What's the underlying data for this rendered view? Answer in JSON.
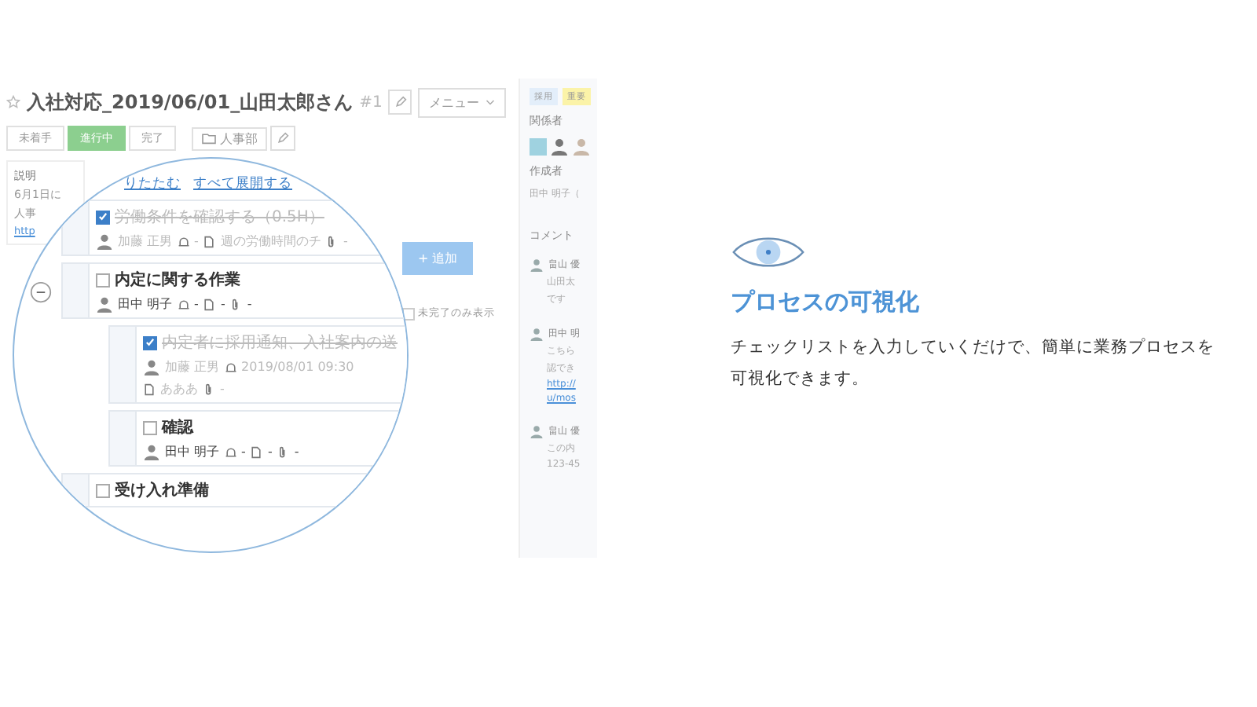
{
  "app": {
    "title": "入社対応_2019/06/01_山田太郎さん",
    "number": "#1",
    "menu": "メニュー",
    "status_tabs": [
      {
        "label": "未着手",
        "selected": false
      },
      {
        "label": "進行中",
        "selected": true
      },
      {
        "label": "完了",
        "selected": false
      }
    ],
    "folder": "人事部",
    "description": {
      "label": "説明",
      "lines": [
        "6月1日に",
        "人事"
      ],
      "link": "http"
    },
    "add_button": "+ 追加",
    "filter": {
      "label": "未完了のみ表示",
      "checked": false
    },
    "sidebar": {
      "tags": [
        {
          "label": "採用",
          "color": "#e3eefa"
        },
        {
          "label": "重要",
          "color": "#fbf3a8"
        }
      ],
      "members_label": "関係者",
      "author_label": "作成者",
      "author": "田中 明子（",
      "comments_label": "コメント",
      "comments": [
        {
          "author": "畠山 優",
          "lines": [
            "山田太",
            "です"
          ]
        },
        {
          "author": "田中 明",
          "lines": [
            "こちら",
            "認でき"
          ],
          "links": [
            "http://",
            "u/mos"
          ]
        },
        {
          "author": "畠山 優",
          "lines": [
            "この内",
            "123-45"
          ]
        }
      ]
    }
  },
  "magnifier": {
    "toolbar": [
      "りたたむ",
      "すべて展開する"
    ],
    "items": [
      {
        "title": "労働条件を確認する（0.5H）",
        "checked": true,
        "assignee": "加藤 正男",
        "meta": [
          {
            "kind": "bell",
            "text": "-"
          },
          {
            "kind": "doc",
            "text": "週の労働時間のチ"
          },
          {
            "kind": "clip",
            "text": "-"
          }
        ]
      },
      {
        "title": "内定に関する作業",
        "checked": false,
        "expanded": true,
        "assignee": "田中 明子",
        "meta": [
          {
            "kind": "bell",
            "text": "-"
          },
          {
            "kind": "doc",
            "text": "-"
          },
          {
            "kind": "clip",
            "text": "-"
          }
        ],
        "children": [
          {
            "title": "内定者に採用通知、入社案内の送",
            "checked": true,
            "assignee": "加藤 正男",
            "meta": [
              {
                "kind": "bell",
                "text": "2019/08/01 09:30"
              },
              {
                "kind": "doc",
                "text": "あああ"
              },
              {
                "kind": "clip",
                "text": "-"
              }
            ]
          },
          {
            "title": "確認",
            "checked": false,
            "assignee": "田中 明子",
            "meta": [
              {
                "kind": "bell",
                "text": "-"
              },
              {
                "kind": "doc",
                "text": "-"
              },
              {
                "kind": "clip",
                "text": "-"
              }
            ]
          }
        ]
      },
      {
        "title": "受け入れ準備",
        "checked": false
      }
    ]
  },
  "feature": {
    "title": "プロセスの可視化",
    "text": "チェックリストを入力していくだけで、簡単に業務プロセスを可視化できます。"
  }
}
